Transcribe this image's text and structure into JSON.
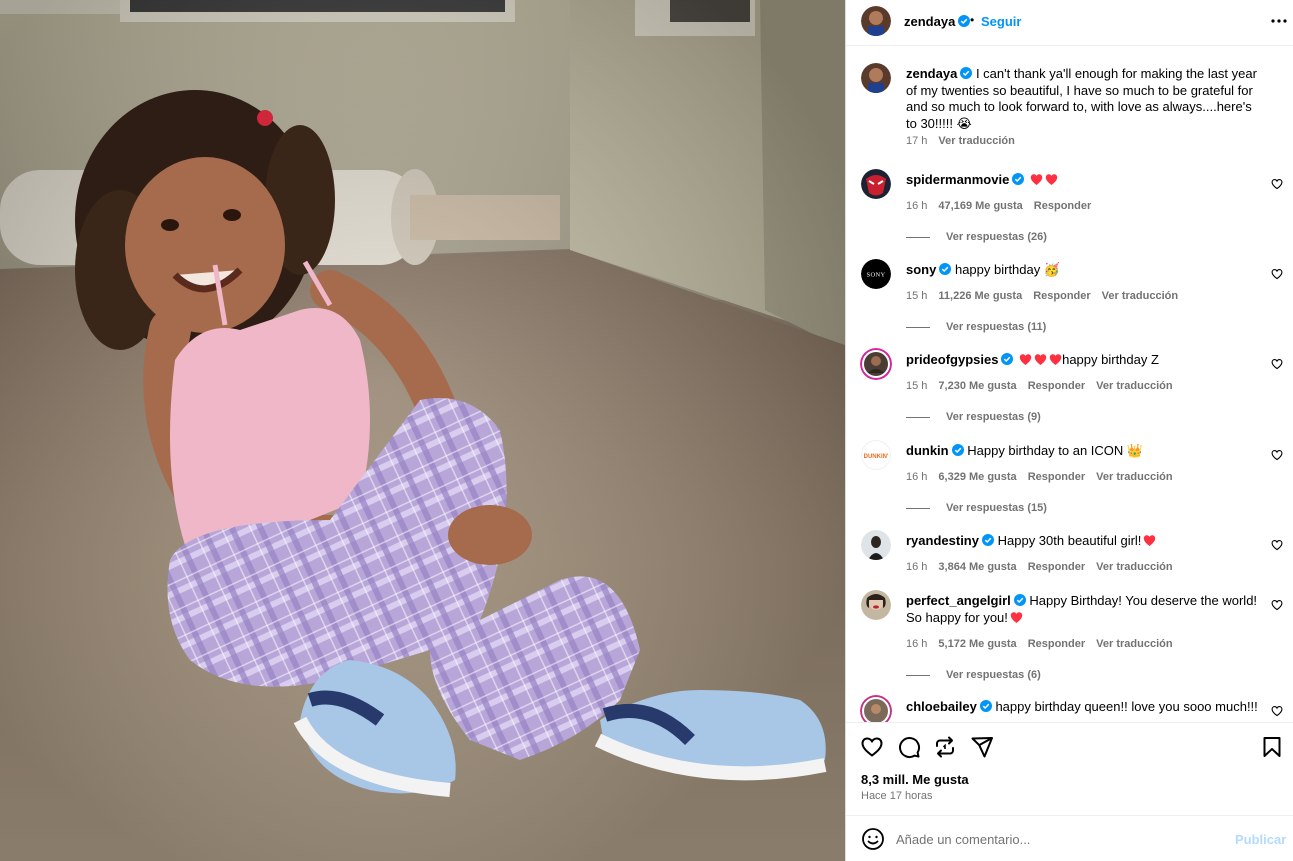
{
  "post": {
    "author": "zendaya",
    "follow_label": "Seguir",
    "separator": "•",
    "caption": "I can't thank ya'll enough for making the last year of my twenties so beautiful, I have so much to be grateful for and so much to look forward to, with love as always....here's to 30!!!!! 😭",
    "caption_time": "17 h",
    "caption_translate": "Ver traducción",
    "likes": "8,3 mill. Me gusta",
    "time_ago": "Hace 17 horas"
  },
  "comments": [
    {
      "user": "spidermanmovie",
      "text": "",
      "emoji": "hearts2",
      "time": "16 h",
      "likes": "47,169 Me gusta",
      "reply": "Responder",
      "translate": "",
      "replies": "Ver respuestas (26)",
      "avatar": "spiderman-avatar"
    },
    {
      "user": "sony",
      "text": "happy birthday 🥳",
      "emoji": "",
      "time": "15 h",
      "likes": "11,226 Me gusta",
      "reply": "Responder",
      "translate": "Ver traducción",
      "replies": "Ver respuestas (11)",
      "avatar": "sony-logo-avatar"
    },
    {
      "user": "prideofgypsies",
      "text": "happy birthday Z",
      "emoji": "hearts3",
      "time": "15 h",
      "likes": "7,230 Me gusta",
      "reply": "Responder",
      "translate": "Ver traducción",
      "replies": "Ver respuestas (9)",
      "avatar": "prideofgypsies-avatar"
    },
    {
      "user": "dunkin",
      "text": "Happy birthday to an ICON 👑",
      "emoji": "",
      "time": "16 h",
      "likes": "6,329 Me gusta",
      "reply": "Responder",
      "translate": "Ver traducción",
      "replies": "Ver respuestas (15)",
      "avatar": "dunkin-logo-avatar"
    },
    {
      "user": "ryandestiny",
      "text": "Happy 30th beautiful girl!",
      "emoji": "heart1",
      "time": "16 h",
      "likes": "3,864 Me gusta",
      "reply": "Responder",
      "translate": "Ver traducción",
      "replies": "",
      "avatar": "ryandestiny-avatar"
    },
    {
      "user": "perfect_angelgirl",
      "text": "Happy Birthday! You deserve the world! So happy for you!",
      "emoji": "heart1",
      "time": "16 h",
      "likes": "5,172 Me gusta",
      "reply": "Responder",
      "translate": "Ver traducción",
      "replies": "Ver respuestas (6)",
      "avatar": "perfect-angelgirl-avatar"
    },
    {
      "user": "chloebailey",
      "text": "happy birthday queen!! love you sooo much!!!",
      "emoji": "",
      "time": "",
      "likes": "",
      "reply": "",
      "translate": "",
      "replies": "",
      "avatar": "chloebailey-avatar"
    }
  ],
  "compose": {
    "placeholder": "Añade un comentario...",
    "publish_label": "Publicar"
  },
  "colors": {
    "link_blue": "#0095f6",
    "publish_disabled": "#b3dbff",
    "secondary_text": "#737373",
    "verified_blue": "#0095f6",
    "heart_red": "#ff3040"
  },
  "icons": [
    "more-options-icon",
    "verified-badge-icon",
    "like-heart-icon",
    "comment-icon",
    "share-icon",
    "send-icon",
    "save-bookmark-icon",
    "emoji-smile-icon",
    "comment-like-heart-icon"
  ]
}
